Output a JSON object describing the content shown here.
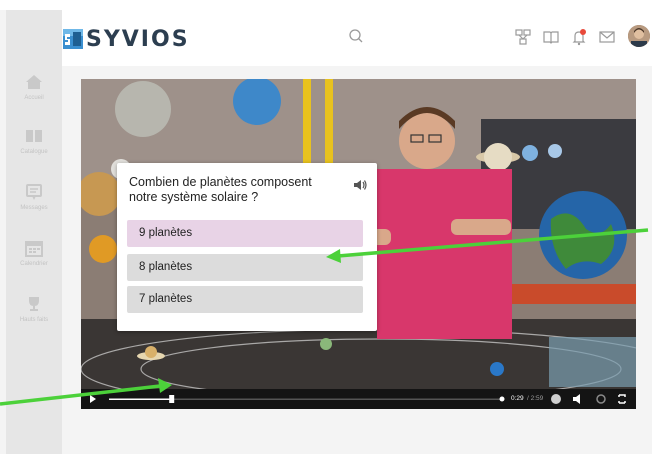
{
  "app": {
    "logo_text": "SYVIOS"
  },
  "sidebar": {
    "items": [
      {
        "label": "Accueil",
        "icon": "home-icon"
      },
      {
        "label": "Catalogue",
        "icon": "book-icon"
      },
      {
        "label": "Messages",
        "icon": "message-icon"
      },
      {
        "label": "Calendrier",
        "icon": "calendar-icon"
      },
      {
        "label": "Hauts faits",
        "icon": "trophy-icon"
      }
    ]
  },
  "header": {
    "icons": [
      "search-icon",
      "network-icon",
      "book-open-icon",
      "bell-icon",
      "mail-icon",
      "avatar"
    ]
  },
  "quiz": {
    "question": "Combien de planètes composent notre système solaire ?",
    "options": [
      {
        "label": "9 planètes",
        "highlighted": true
      },
      {
        "label": "8 planètes",
        "highlighted": false
      },
      {
        "label": "7 planètes",
        "highlighted": false
      }
    ]
  },
  "player": {
    "time_current": "0:29",
    "time_total": "/ 2:59",
    "progress": 0.16
  },
  "colors": {
    "accent": "#2a7fb8",
    "option_highlight": "#e8d3e6",
    "option_default": "#dcdcdc",
    "arrow": "#4cd13a",
    "notification": "#e8493a"
  }
}
